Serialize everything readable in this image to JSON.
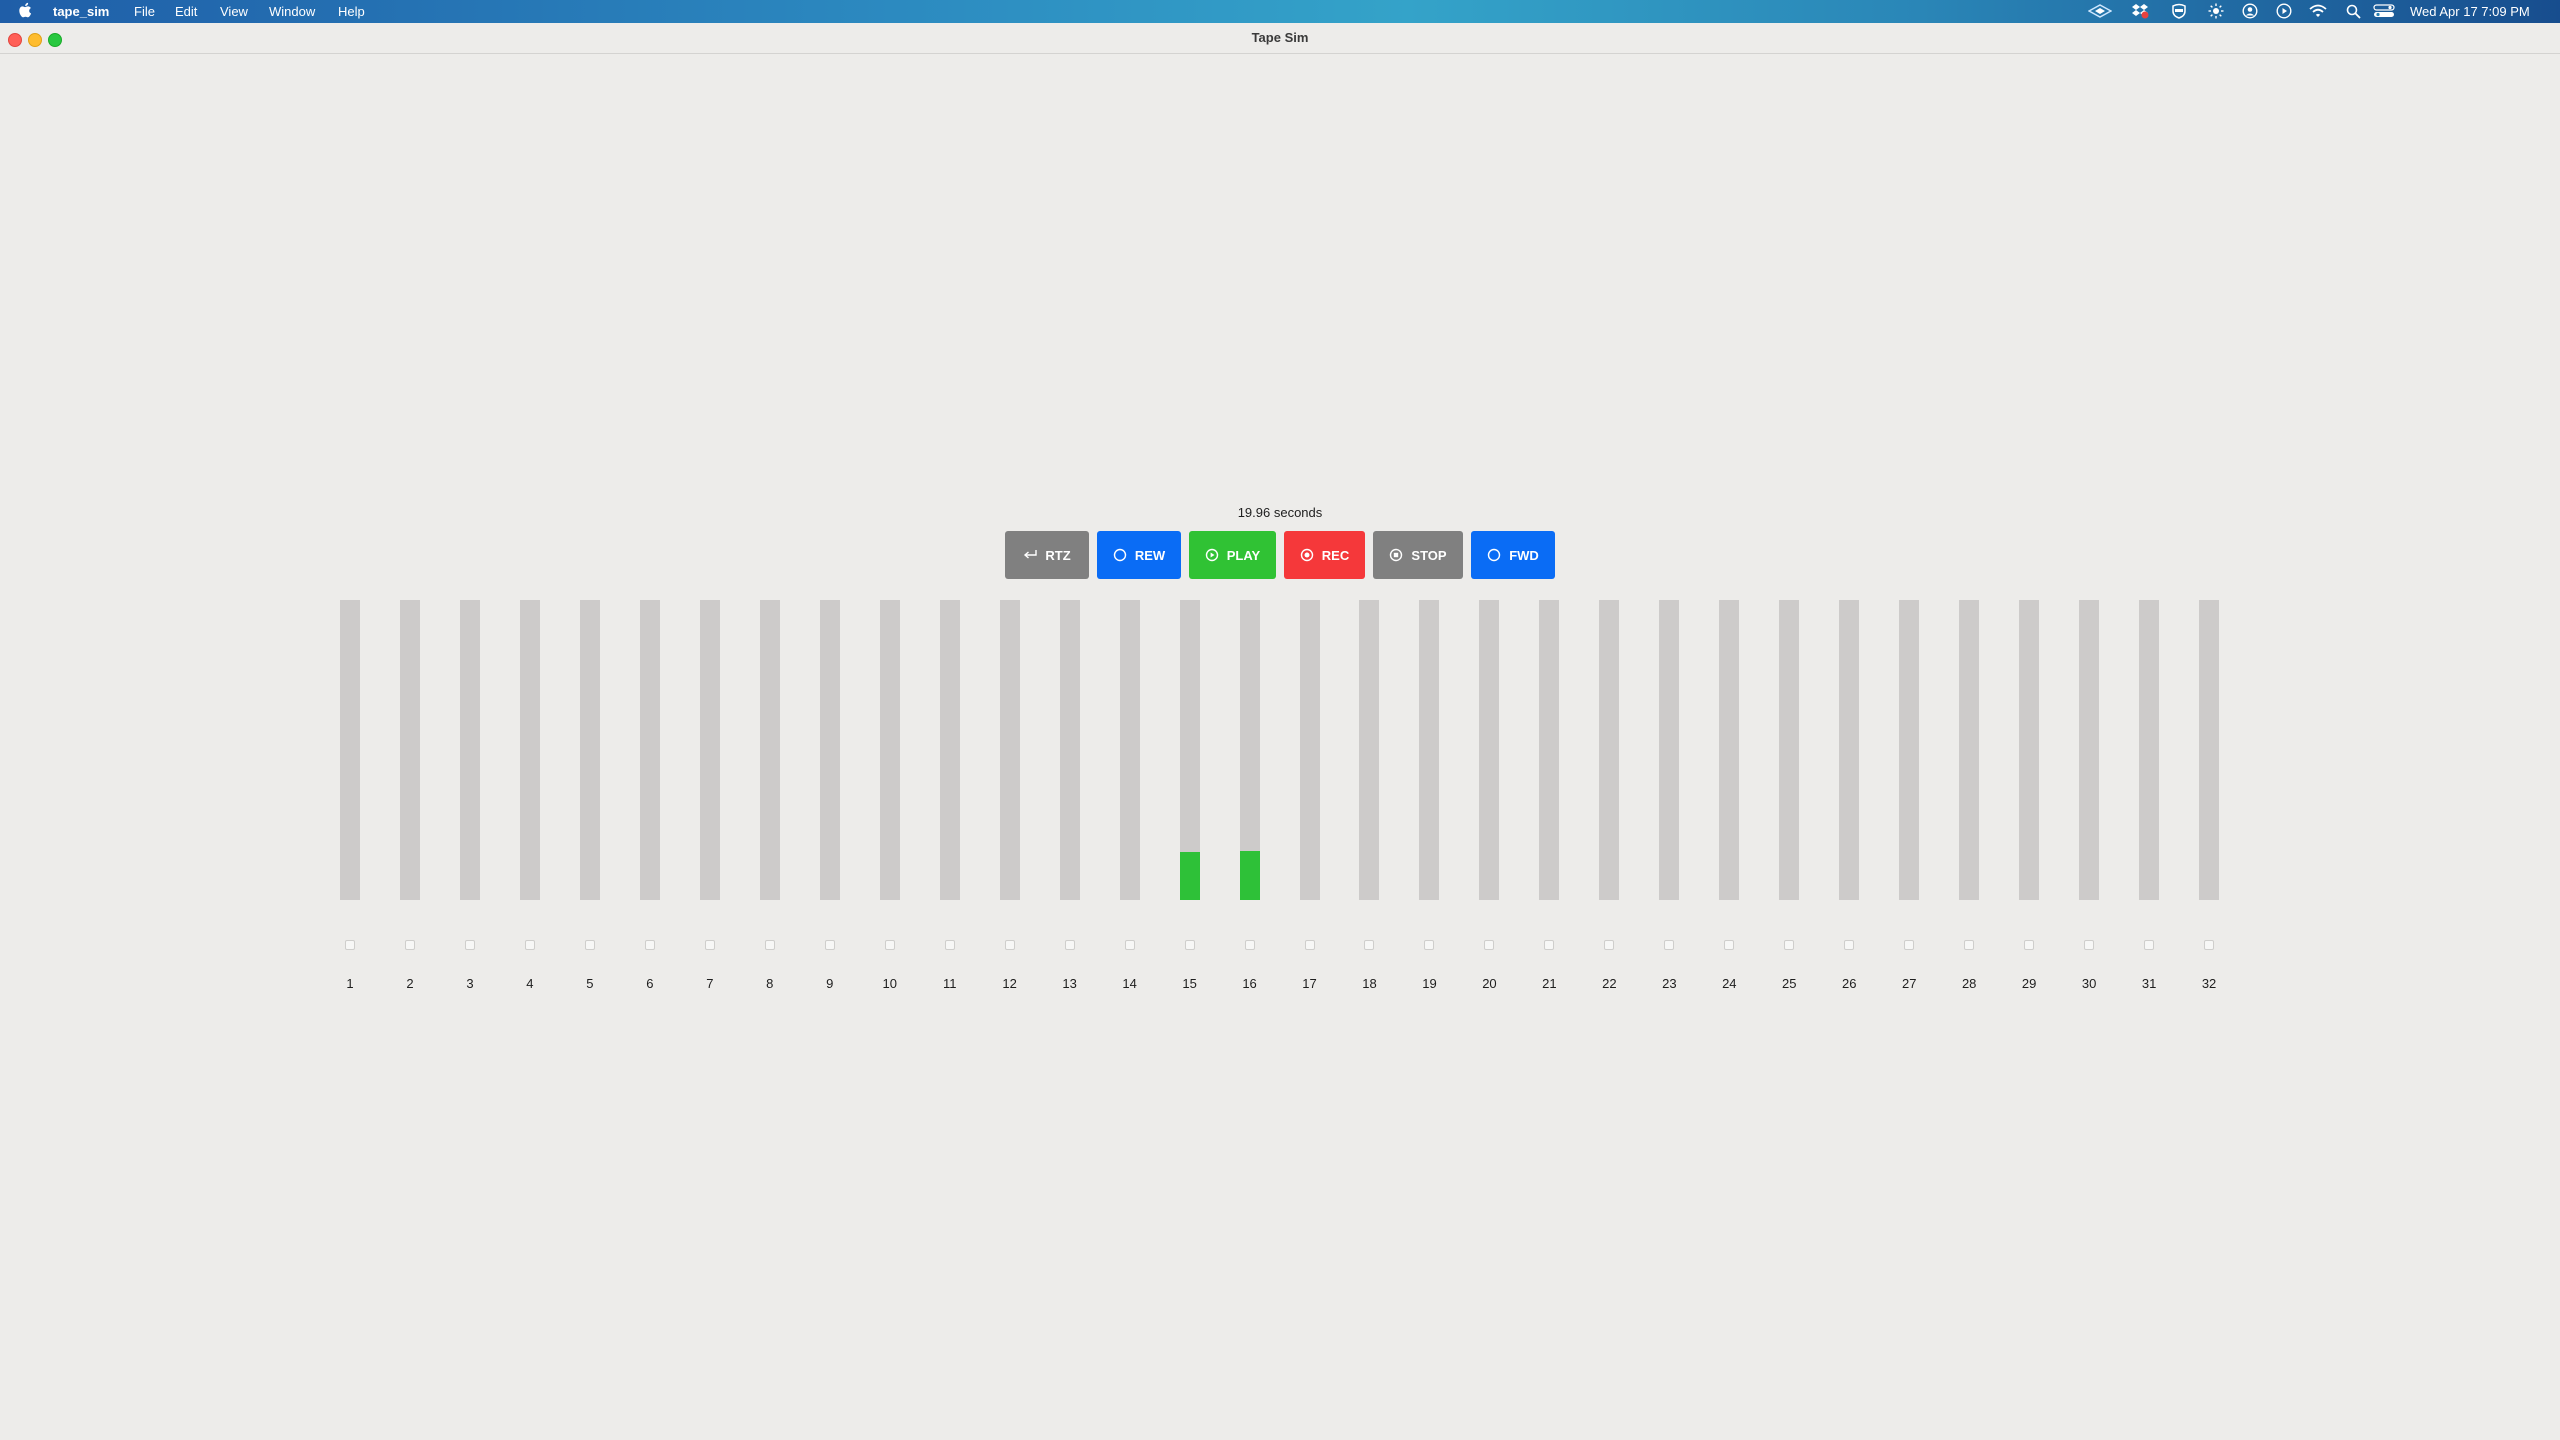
{
  "menubar": {
    "app_name": "tape_sim",
    "menus": [
      "File",
      "Edit",
      "View",
      "Window",
      "Help"
    ],
    "status_icons": [
      "network-diamond-icon",
      "dropbox-icon",
      "shield-icon",
      "brightness-icon",
      "user-circle-icon",
      "play-circle-icon",
      "wifi-icon",
      "search-icon",
      "control-center-icon"
    ],
    "clock": "Wed Apr 17  7:09 PM"
  },
  "window": {
    "title": "Tape Sim"
  },
  "transport": {
    "time_display": "19.96 seconds",
    "buttons": [
      {
        "id": "rtz",
        "label": "RTZ",
        "icon": "return-arrow-icon",
        "color": "#808080"
      },
      {
        "id": "rew",
        "label": "REW",
        "icon": "circle-icon",
        "color": "#0a6cf5"
      },
      {
        "id": "play",
        "label": "PLAY",
        "icon": "play-circle-icon",
        "color": "#30c234"
      },
      {
        "id": "rec",
        "label": "REC",
        "icon": "record-circle-icon",
        "color": "#f5383a"
      },
      {
        "id": "stop",
        "label": "STOP",
        "icon": "stop-circle-icon",
        "color": "#808080"
      },
      {
        "id": "fwd",
        "label": "FWD",
        "icon": "circle-icon",
        "color": "#0a6cf5"
      }
    ]
  },
  "tracks": {
    "meter_color": "#2ec138",
    "items": [
      {
        "number": "1",
        "level": 0,
        "armed": false
      },
      {
        "number": "2",
        "level": 0,
        "armed": false
      },
      {
        "number": "3",
        "level": 0,
        "armed": false
      },
      {
        "number": "4",
        "level": 0,
        "armed": false
      },
      {
        "number": "5",
        "level": 0,
        "armed": false
      },
      {
        "number": "6",
        "level": 0,
        "armed": false
      },
      {
        "number": "7",
        "level": 0,
        "armed": false
      },
      {
        "number": "8",
        "level": 0,
        "armed": false
      },
      {
        "number": "9",
        "level": 0,
        "armed": false
      },
      {
        "number": "10",
        "level": 0,
        "armed": false
      },
      {
        "number": "11",
        "level": 0,
        "armed": false
      },
      {
        "number": "12",
        "level": 0,
        "armed": false
      },
      {
        "number": "13",
        "level": 0,
        "armed": false
      },
      {
        "number": "14",
        "level": 0,
        "armed": false
      },
      {
        "number": "15",
        "level": 0.16,
        "armed": false
      },
      {
        "number": "16",
        "level": 0.165,
        "armed": false
      },
      {
        "number": "17",
        "level": 0,
        "armed": false
      },
      {
        "number": "18",
        "level": 0,
        "armed": false
      },
      {
        "number": "19",
        "level": 0,
        "armed": false
      },
      {
        "number": "20",
        "level": 0,
        "armed": false
      },
      {
        "number": "21",
        "level": 0,
        "armed": false
      },
      {
        "number": "22",
        "level": 0,
        "armed": false
      },
      {
        "number": "23",
        "level": 0,
        "armed": false
      },
      {
        "number": "24",
        "level": 0,
        "armed": false
      },
      {
        "number": "25",
        "level": 0,
        "armed": false
      },
      {
        "number": "26",
        "level": 0,
        "armed": false
      },
      {
        "number": "27",
        "level": 0,
        "armed": false
      },
      {
        "number": "28",
        "level": 0,
        "armed": false
      },
      {
        "number": "29",
        "level": 0,
        "armed": false
      },
      {
        "number": "30",
        "level": 0,
        "armed": false
      },
      {
        "number": "31",
        "level": 0,
        "armed": false
      },
      {
        "number": "32",
        "level": 0,
        "armed": false
      }
    ]
  }
}
